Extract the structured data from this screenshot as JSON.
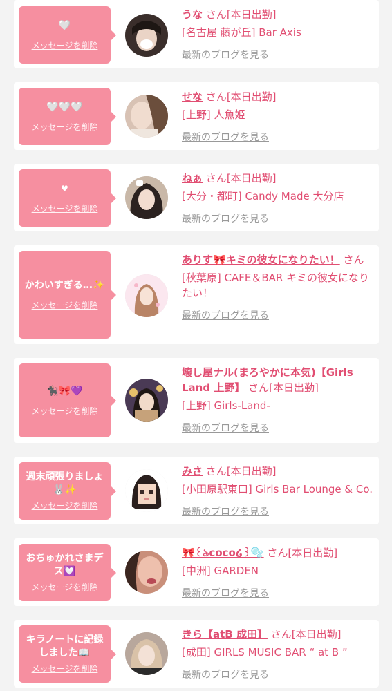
{
  "delete_label": "メッセージを削除",
  "blog_label": "最新のブログを見る",
  "san_suffix": "さん",
  "on_duty": "[本日出勤]",
  "cards": [
    {
      "message": "🤍",
      "name": "うな",
      "shop": "[名古屋 藤が丘] Bar Axis"
    },
    {
      "message": "🤍🤍🤍",
      "name": "せな",
      "shop": "[上野] 人魚姫"
    },
    {
      "message": "♥",
      "name": "ねぁ",
      "shop": "[大分・都町] Candy Made 大分店"
    },
    {
      "message": "かわいすぎる…✨",
      "name": "ありす🎀キミの彼女になりたい！",
      "shop": "[秋葉原] CAFE＆BAR キミの彼女になりたい！"
    },
    {
      "message": "🐈‍⬛🎀💜",
      "name": "壊し屋ナル(まろやかに本気)【Girls Land 上野】",
      "shop": "[上野] Girls-Land-"
    },
    {
      "message": "週末頑張りましょ🐰✨",
      "name": "みさ",
      "shop": "[小田原駅東口] Girls Bar Lounge & Co."
    },
    {
      "message": "おちゅかれさまデス💟",
      "name": "🎀꒰ঌcoco໒꒱🫧",
      "shop": "[中洲] GARDEN"
    },
    {
      "message": "キラノートに記録しました📖",
      "name": "きら【atB 成田】",
      "shop": "[成田] GIRLS MUSIC BAR “ at B ”"
    }
  ],
  "colors": {
    "accent": "#f68fa0",
    "text_pink": "#e14e72",
    "muted": "#999999",
    "bg": "#f3f3f3"
  }
}
